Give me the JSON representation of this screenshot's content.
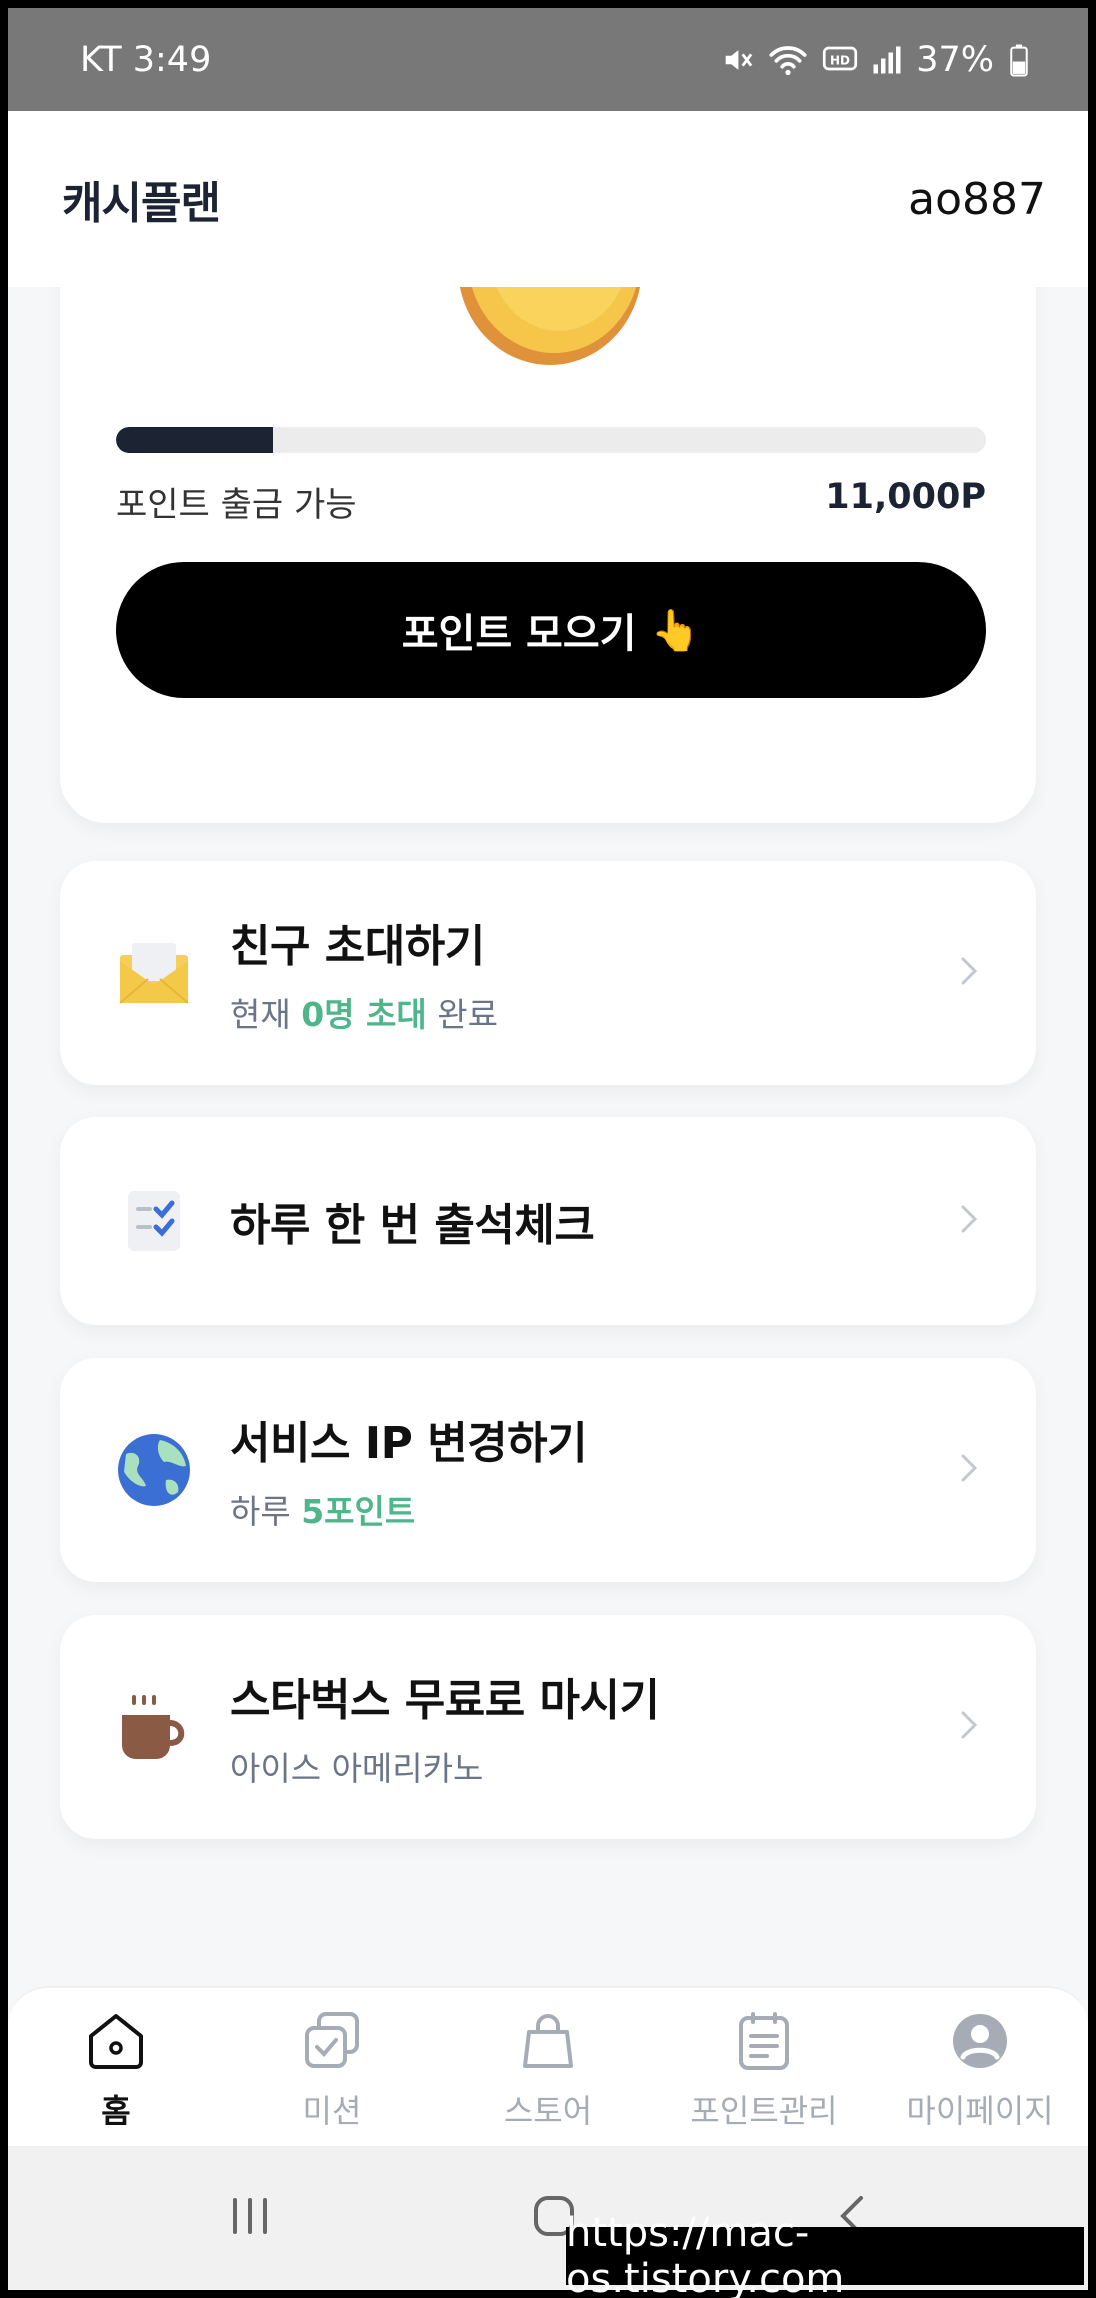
{
  "status_bar": {
    "carrier_time": "KT 3:49",
    "battery": "37%",
    "icons": [
      "mute-icon",
      "wifi-icon",
      "hd-call-icon",
      "signal-icon",
      "battery-icon"
    ]
  },
  "header": {
    "app_title": "캐시플랜",
    "user_id": "ao887"
  },
  "point_card": {
    "progress_fraction": 0.18,
    "withdraw_label": "포인트 출금 가능",
    "withdraw_amount": "11,000P",
    "collect_button_label": "포인트 모으기",
    "collect_button_emoji": "👆"
  },
  "menu": [
    {
      "icon": "envelope-icon",
      "title": "친구 초대하기",
      "sub_prefix": "현재 ",
      "sub_highlight": "0명 초대",
      "sub_suffix": " 완료"
    },
    {
      "icon": "checklist-icon",
      "title": "하루 한 번 출석체크"
    },
    {
      "icon": "globe-icon",
      "title": "서비스 IP 변경하기",
      "sub_prefix": "하루 ",
      "sub_highlight": "5포인트",
      "sub_suffix": ""
    },
    {
      "icon": "coffee-icon",
      "title": "스타벅스 무료로 마시기",
      "sub_prefix": "아이스 아메리카노",
      "sub_highlight": "",
      "sub_suffix": ""
    }
  ],
  "bottom_nav": [
    {
      "icon": "home-icon",
      "label": "홈",
      "active": true
    },
    {
      "icon": "mission-icon",
      "label": "미션",
      "active": false
    },
    {
      "icon": "store-bag-icon",
      "label": "스토어",
      "active": false
    },
    {
      "icon": "point-manage-icon",
      "label": "포인트관리",
      "active": false
    },
    {
      "icon": "profile-icon",
      "label": "마이페이지",
      "active": false
    }
  ],
  "watermark": "https://mac-os.tistory.com",
  "colors": {
    "accent_green": "#4fb58a",
    "navy": "#1c2434",
    "button_black": "#000000"
  }
}
